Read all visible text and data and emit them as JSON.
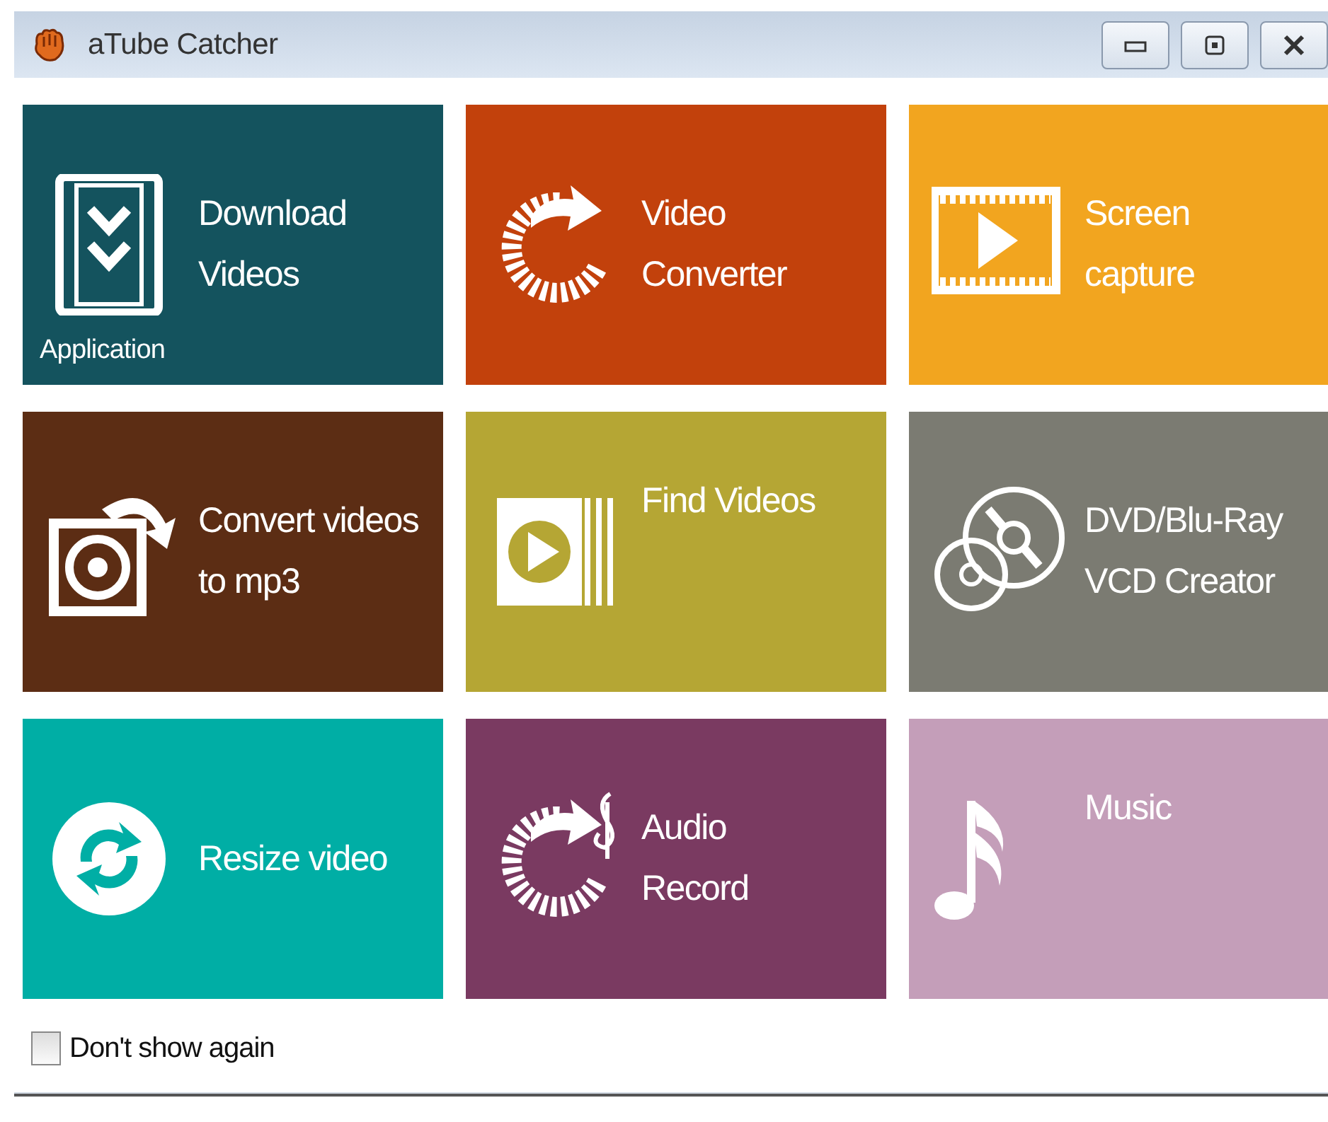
{
  "window": {
    "title": "aTube Catcher"
  },
  "tiles": [
    {
      "kind": "download",
      "label": "Download\nVideos",
      "subtitle": "Application",
      "color": "#14535e"
    },
    {
      "kind": "converter",
      "label": "Video\nConverter",
      "color": "#c2410c"
    },
    {
      "kind": "screen",
      "label": "Screen\ncapture",
      "color": "#f2a51f"
    },
    {
      "kind": "mp3",
      "label": "Convert videos\nto mp3",
      "color": "#5c2d14"
    },
    {
      "kind": "find",
      "label": "Find Videos",
      "color": "#b5a634"
    },
    {
      "kind": "disc",
      "label": "DVD/Blu-Ray\nVCD Creator",
      "color": "#7b7b72"
    },
    {
      "kind": "resize",
      "label": "Resize video",
      "color": "#00aea5"
    },
    {
      "kind": "audio",
      "label": "Audio\nRecord",
      "color": "#7a3a61"
    },
    {
      "kind": "music",
      "label": "Music",
      "color": "#c49eb9"
    }
  ],
  "dont_show_again": {
    "label": "Don't show again",
    "checked": false
  }
}
